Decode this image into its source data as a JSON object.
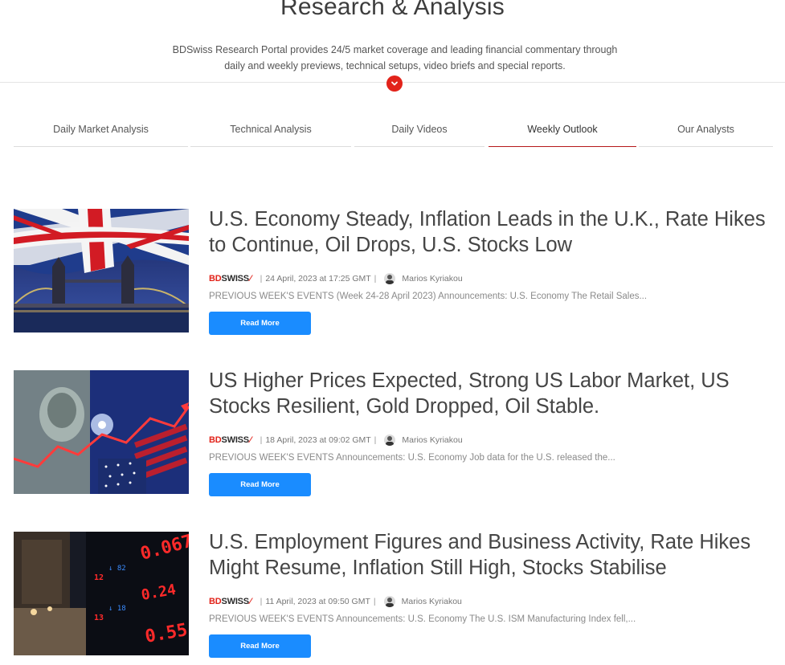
{
  "header": {
    "title": "Research & Analysis",
    "description_line1": "BDSwiss Research Portal provides 24/5 market coverage and leading financial commentary through",
    "description_line2": "daily and weekly previews, technical setups, video briefs and special reports."
  },
  "tabs": [
    {
      "label": "Daily Market Analysis",
      "active": false
    },
    {
      "label": "Technical Analysis",
      "active": false
    },
    {
      "label": "Daily Videos",
      "active": false
    },
    {
      "label": "Weekly Outlook",
      "active": true
    },
    {
      "label": "Our Analysts",
      "active": false
    }
  ],
  "brand": {
    "logo_part1": "BD",
    "logo_part2": "SWISS",
    "accent_color": "#e2231a",
    "button_color": "#1a8cff"
  },
  "articles": [
    {
      "title_line1": "U.S. Economy Steady, Inflation Leads in the U.K., Rate Hikes",
      "title_line2": "to Continue, Oil Drops, U.S. Stocks Low",
      "date": "24 April, 2023 at 17:25 GMT",
      "author": "Marios Kyriakou",
      "excerpt": "PREVIOUS WEEK'S EVENTS (Week 24-28 April 2023) Announcements:  U.S. Economy The Retail Sales...",
      "button": "Read More",
      "image": "london-tower-bridge-uk-flag"
    },
    {
      "title_line1": "US Higher Prices Expected, Strong US Labor Market, US",
      "title_line2": "Stocks Resilient, Gold Dropped, Oil Stable.",
      "date": "18 April, 2023 at 09:02 GMT",
      "author": "Marios Kyriakou",
      "excerpt": "PREVIOUS WEEK'S EVENTS Announcements:    U.S. Economy Job data for the U.S. released the...",
      "button": "Read More",
      "image": "us-dollar-flag-chart"
    },
    {
      "title_line1": "U.S. Employment Figures and Business Activity, Rate Hikes",
      "title_line2": "Might Resume, Inflation Still High, Stocks Stabilise",
      "date": "11 April, 2023 at 09:50 GMT",
      "author": "Marios Kyriakou",
      "excerpt": "PREVIOUS WEEK'S EVENTS Announcements:  U.S. Economy The U.S. ISM Manufacturing Index fell,...",
      "button": "Read More",
      "image": "stock-ticker-board-street"
    }
  ]
}
